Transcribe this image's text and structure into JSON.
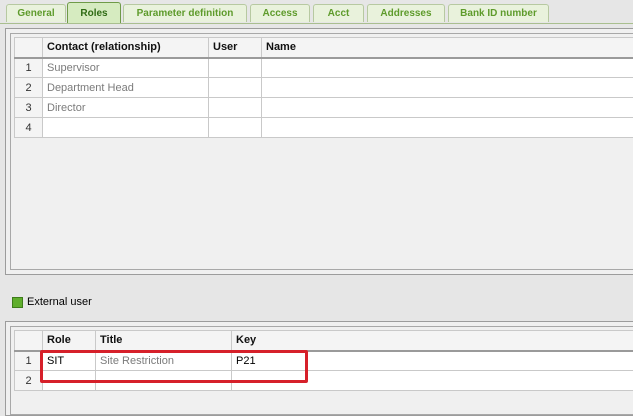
{
  "tabs": [
    {
      "label": "General"
    },
    {
      "label": "Roles",
      "active": true
    },
    {
      "label": "Parameter definition"
    },
    {
      "label": "Access"
    },
    {
      "label": "Acct"
    },
    {
      "label": "Addresses"
    },
    {
      "label": "Bank ID number"
    }
  ],
  "contacts_grid": {
    "columns": [
      "Contact (relationship)",
      "User",
      "Name"
    ],
    "rows": [
      {
        "num": "1",
        "contact": "Supervisor",
        "user": "",
        "name": ""
      },
      {
        "num": "2",
        "contact": "Department Head",
        "user": "",
        "name": ""
      },
      {
        "num": "3",
        "contact": "Director",
        "user": "",
        "name": ""
      },
      {
        "num": "4",
        "contact": "",
        "user": "",
        "name": ""
      }
    ]
  },
  "external_user": {
    "label": "External user",
    "color": "#5fae2c"
  },
  "roles_grid": {
    "columns": [
      "Role",
      "Title",
      "Key"
    ],
    "rows": [
      {
        "num": "1",
        "role": "SIT",
        "title": "Site Restriction",
        "key": "P21"
      },
      {
        "num": "2",
        "role": "",
        "title": "",
        "key": ""
      }
    ]
  },
  "colors": {
    "tab_text": "#5e9b2b",
    "highlight": "#d6202a"
  }
}
